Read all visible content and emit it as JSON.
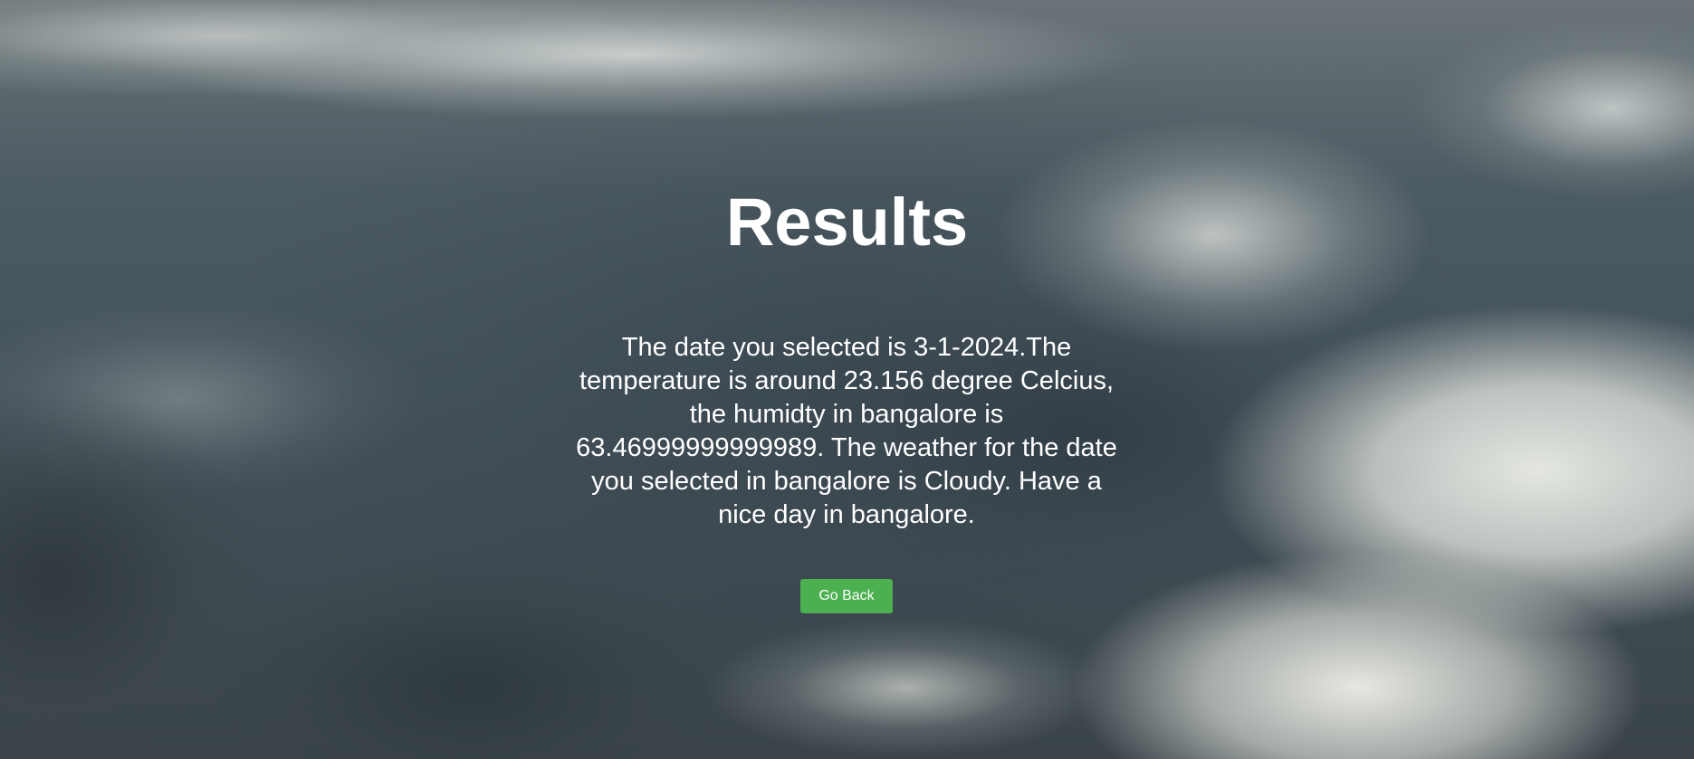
{
  "page": {
    "title": "Results",
    "message": "The date you selected is 3-1-2024.The temperature is around 23.156 degree Celcius, the humidty in bangalore is 63.46999999999989. The weather for the date you selected in bangalore is Cloudy. Have a nice day in bangalore.",
    "back_button_label": "Go Back"
  },
  "colors": {
    "button_bg": "#4caf50",
    "text": "#ffffff"
  }
}
